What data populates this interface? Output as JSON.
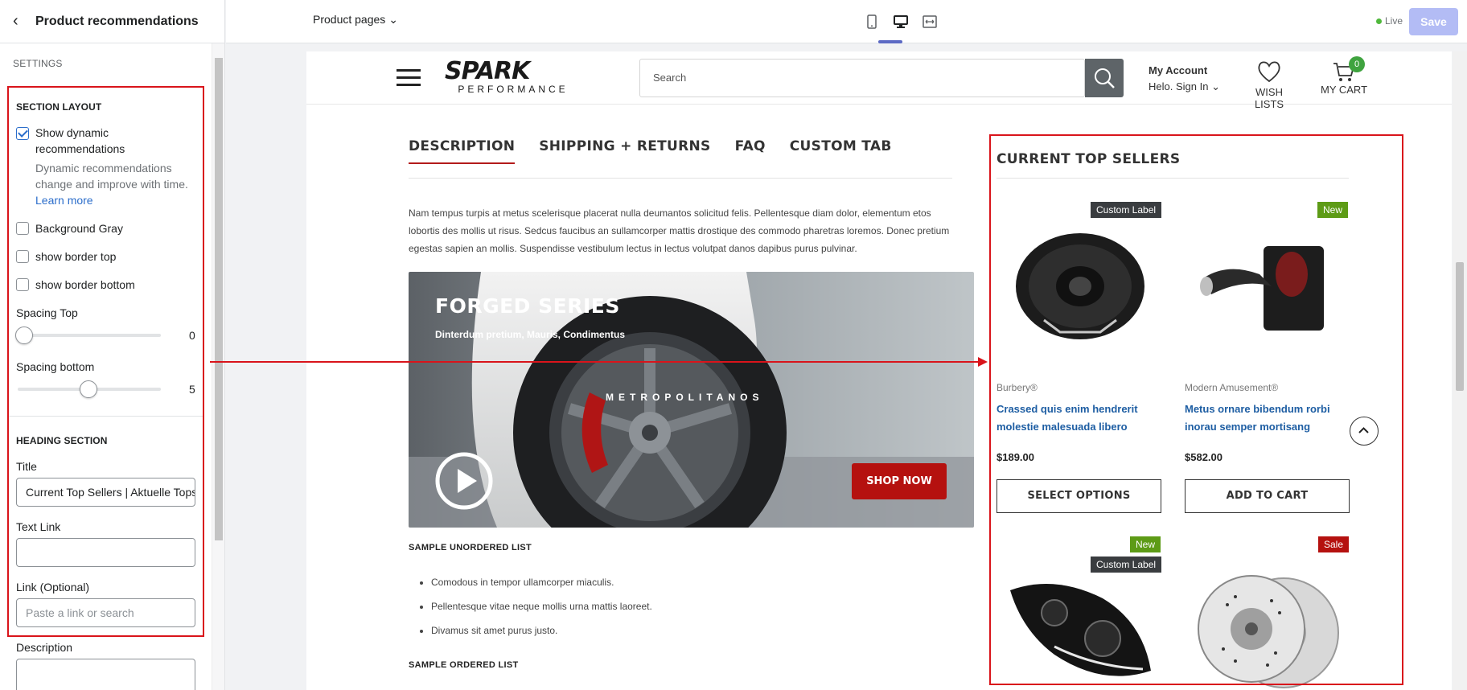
{
  "sidebar": {
    "back": "‹",
    "title": "Product recommendations",
    "settings_label": "SETTINGS",
    "section_layout": "SECTION LAYOUT",
    "show_dynamic_l1": "Show dynamic",
    "show_dynamic_l2": "recommendations",
    "dyn_help_l1": "Dynamic recommendations",
    "dyn_help_l2": "change and improve with time.",
    "learn_more": "Learn more",
    "bg_gray": "Background Gray",
    "border_top": "show border top",
    "border_bottom": "show border bottom",
    "spacing_top_label": "Spacing Top",
    "spacing_top_value": "0",
    "spacing_bottom_label": "Spacing bottom",
    "spacing_bottom_value": "5",
    "heading_section": "HEADING SECTION",
    "title_label": "Title",
    "title_value": "Current Top Sellers | Aktuelle Topseller",
    "text_link_label": "Text Link",
    "text_link_value": "",
    "link_label": "Link (Optional)",
    "link_placeholder": "Paste a link or search",
    "description_label": "Description"
  },
  "topbar": {
    "page_selector": "Product pages",
    "live": "Live",
    "save": "Save"
  },
  "store": {
    "logo_top": "SPARK",
    "logo_bottom": "PERFORMANCE",
    "search_placeholder": "Search",
    "my_account": "My Account",
    "sign_in": "Helo. Sign In",
    "wish_lists": "WISH LISTS",
    "my_cart": "MY CART",
    "cart_count": "0"
  },
  "tabs": [
    "DESCRIPTION",
    "SHIPPING + RETURNS",
    "FAQ",
    "CUSTOM TAB"
  ],
  "description": "Nam tempus turpis at metus scelerisque placerat nulla deumantos solicitud felis. Pellentesque diam dolor, elementum etos lobortis des mollis ut risus. Sedcus faucibus an sullamcorper mattis drostique des commodo pharetras loremos. Donec pretium egestas sapien an mollis. Suspendisse vestibulum lectus in lectus volutpat danos dapibus purus pulvinar.",
  "banner": {
    "title": "FORGED SERIES",
    "subtitle": "Dinterdum pretium, Mauris, Condimentus",
    "tire_text": "METROPOLITANOS",
    "shop_now": "SHOP NOW"
  },
  "lists": {
    "unordered_title": "SAMPLE UNORDERED LIST",
    "items": [
      "Comodous in tempor ullamcorper miaculis.",
      "Pellentesque vitae neque mollis urna mattis laoreet.",
      "Divamus sit amet purus justo."
    ],
    "ordered_title": "SAMPLE ORDERED LIST"
  },
  "top_sellers": {
    "title": "CURRENT TOP SELLERS",
    "products": [
      {
        "label": "Custom Label",
        "brand": "Burbery®",
        "name_l1": "Crassed quis enim hendrerit",
        "name_l2": "molestie malesuada libero",
        "price": "$189.00",
        "button": "SELECT OPTIONS"
      },
      {
        "label": "New",
        "brand": "Modern Amusement®",
        "name_l1": "Metus ornare bibendum rorbi",
        "name_l2": "inorau semper mortisang",
        "price": "$582.00",
        "button": "ADD TO CART"
      },
      {
        "label": "New",
        "label2": "Custom Label"
      },
      {
        "label": "Sale"
      }
    ]
  },
  "colors": {
    "accent_red": "#d9141b",
    "save_bg": "#b3bcf5",
    "link_blue": "#1e5ea3"
  }
}
